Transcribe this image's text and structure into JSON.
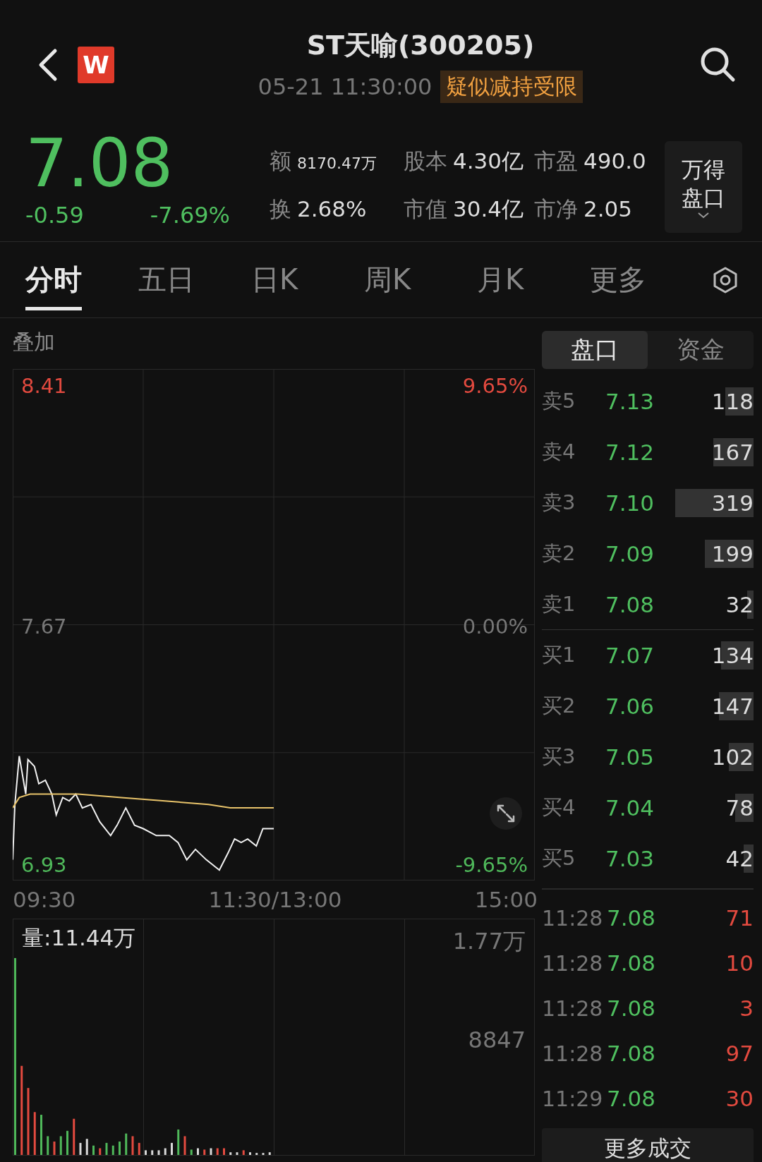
{
  "header": {
    "logo": "W",
    "title": "ST天喻(300205)",
    "datetime": "05-21 11:30:00",
    "tag": "疑似减持受限"
  },
  "quote": {
    "price": "7.08",
    "change": "-0.59",
    "change_pct": "-7.69%",
    "stats": [
      {
        "label": "额",
        "value": "8170.47万"
      },
      {
        "label": "股本",
        "value": "4.30亿"
      },
      {
        "label": "市盈",
        "value": "490.0"
      },
      {
        "label": "换",
        "value": "2.68%"
      },
      {
        "label": "市值",
        "value": "30.4亿"
      },
      {
        "label": "市净",
        "value": "2.05"
      }
    ],
    "panel_button": "万得盘口"
  },
  "tabs": [
    {
      "label": "分时",
      "selected": true
    },
    {
      "label": "五日",
      "selected": false
    },
    {
      "label": "日K",
      "selected": false
    },
    {
      "label": "周K",
      "selected": false
    },
    {
      "label": "月K",
      "selected": false
    },
    {
      "label": "更多",
      "selected": false
    }
  ],
  "overlay_label": "叠加",
  "price_chart": {
    "kind": "picture",
    "left_labels": [
      "8.41",
      "7.67",
      "6.93"
    ],
    "right_labels": [
      "9.65%",
      "0.00%",
      "-9.65%"
    ],
    "time_labels": [
      "09:30",
      "11:30/13:00",
      "15:00"
    ]
  },
  "volume_chart": {
    "kind": "picture",
    "title": "量:11.44万",
    "right_labels": [
      "1.77万",
      "8847"
    ]
  },
  "panel_tabs": [
    {
      "label": "盘口",
      "selected": true
    },
    {
      "label": "资金",
      "selected": false
    }
  ],
  "asks": [
    {
      "label": "卖5",
      "price": "7.13",
      "volume": "118"
    },
    {
      "label": "卖4",
      "price": "7.12",
      "volume": "167"
    },
    {
      "label": "卖3",
      "price": "7.10",
      "volume": "319"
    },
    {
      "label": "卖2",
      "price": "7.09",
      "volume": "199"
    },
    {
      "label": "卖1",
      "price": "7.08",
      "volume": "32"
    }
  ],
  "bids": [
    {
      "label": "买1",
      "price": "7.07",
      "volume": "134"
    },
    {
      "label": "买2",
      "price": "7.06",
      "volume": "147"
    },
    {
      "label": "买3",
      "price": "7.05",
      "volume": "102"
    },
    {
      "label": "买4",
      "price": "7.04",
      "volume": "78"
    },
    {
      "label": "买5",
      "price": "7.03",
      "volume": "42"
    }
  ],
  "trades": [
    {
      "time": "11:28",
      "price": "7.08",
      "volume": "71"
    },
    {
      "time": "11:28",
      "price": "7.08",
      "volume": "10"
    },
    {
      "time": "11:28",
      "price": "7.08",
      "volume": "3"
    },
    {
      "time": "11:28",
      "price": "7.08",
      "volume": "97"
    },
    {
      "time": "11:29",
      "price": "7.08",
      "volume": "30"
    }
  ],
  "more_trades_button": "更多成交"
}
